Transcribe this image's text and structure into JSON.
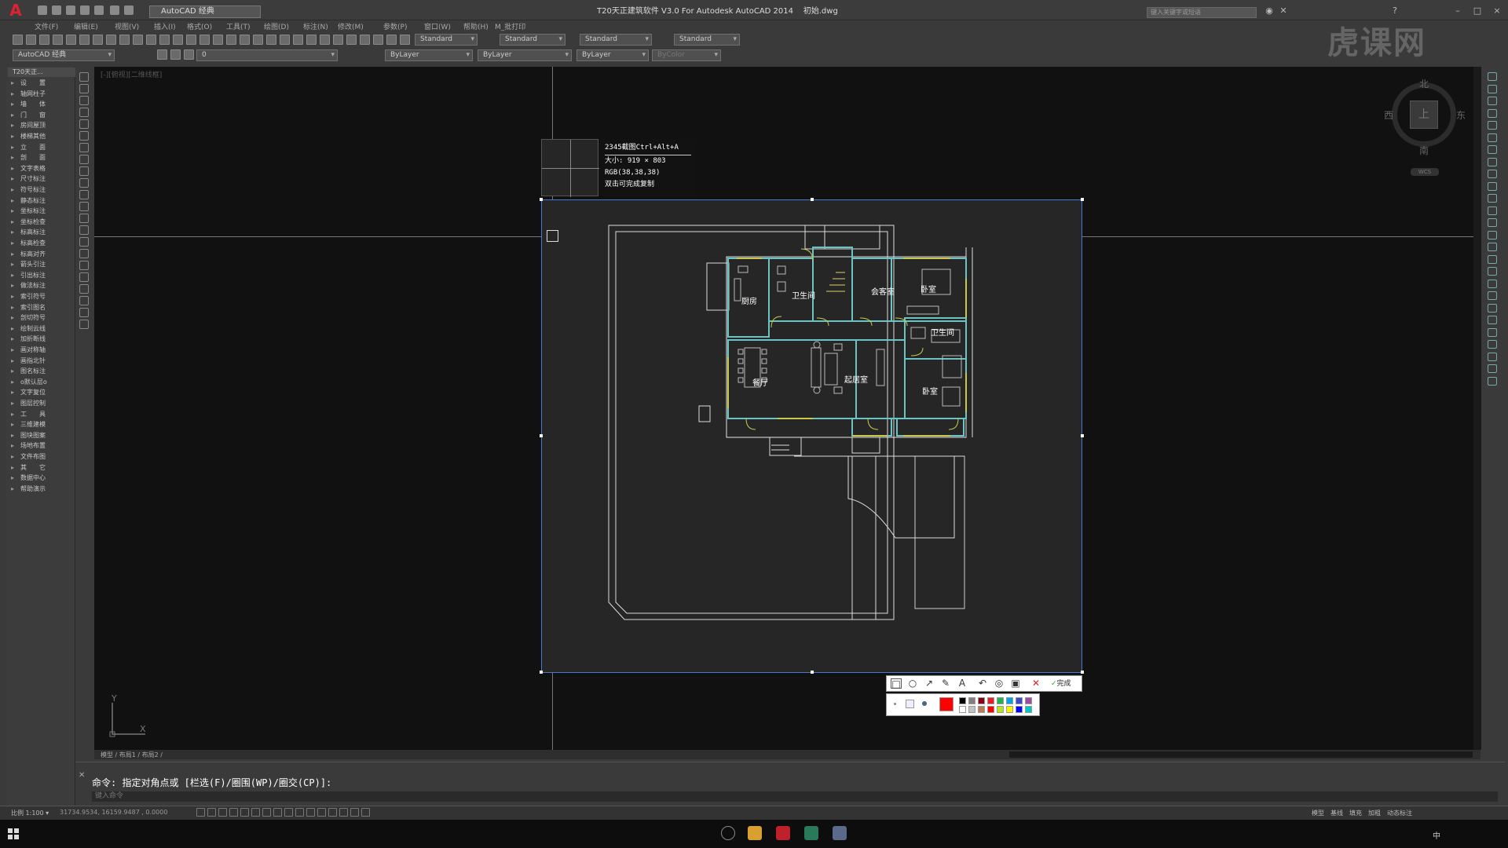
{
  "titlebar": {
    "workspace": "AutoCAD 经典",
    "app_title": "T20天正建筑软件 V3.0 For Autodesk AutoCAD 2014",
    "file_name": "初始.dwg",
    "search_placeholder": "键入关键字或短语"
  },
  "menus": [
    "文件(F)",
    "编辑(E)",
    "视图(V)",
    "插入(I)",
    "格式(O)",
    "工具(T)",
    "绘图(D)",
    "标注(N)",
    "修改(M)",
    "参数(P)",
    "窗口(W)",
    "帮助(H)",
    "M_批打印"
  ],
  "toolbar": {
    "styles": [
      "Standard",
      "Standard",
      "Standard",
      "Standard"
    ],
    "workspace2": "AutoCAD 经典",
    "layer": "0",
    "color": "ByLayer",
    "linetype": "ByLayer",
    "lineweight": "ByLayer",
    "plotstyle": "ByColor"
  },
  "left_panel": {
    "title": "T20天正...",
    "items": [
      "设　　置",
      "轴网柱子",
      "墙　　体",
      "门　　窗",
      "房间屋顶",
      "楼梯其他",
      "立　　面",
      "剖　　面",
      "文字表格",
      "尺寸标注",
      "符号标注",
      "静态标注",
      "坐标标注",
      "坐标检查",
      "标高标注",
      "标高检查",
      "标高对齐",
      "箭头引注",
      "引出标注",
      "做法标注",
      "索引符号",
      "索引图名",
      "剖切符号",
      "绘制云线",
      "加折断线",
      "画对称轴",
      "画指北针",
      "图名标注",
      "o默认层o",
      "文字复位",
      "图层控制",
      "工　　具",
      "三维建模",
      "图块图案",
      "场地布置",
      "文件布图",
      "其　　它",
      "数据中心",
      "帮助演示"
    ]
  },
  "viewport": {
    "label": "[-][俯视][二维线框]",
    "ucs_x": "X",
    "ucs_y": "Y"
  },
  "viewcube": {
    "north": "北",
    "south": "南",
    "east": "东",
    "west": "西",
    "top": "上",
    "wcs": "WCS"
  },
  "capture": {
    "title": "2345截图Ctrl+Alt+A",
    "size": "大小: 919 × 803",
    "rgb": "RGB(38,38,38)",
    "hint": "双击可完成复制",
    "done": "完成"
  },
  "rooms": {
    "kitchen": "厨房",
    "bath1": "卫生间",
    "meeting": "会客室",
    "bedroom1": "卧室",
    "bath2": "卫生间",
    "dining": "餐厅",
    "living": "起居室",
    "bedroom2": "卧室"
  },
  "tabs": "模型 / 布局1 / 布局2 /",
  "command": {
    "line": "命令: 指定对角点或 [栏选(F)/圈围(WP)/圈交(CP)]:",
    "placeholder": "键入命令"
  },
  "status": {
    "scale": "比例 1:100 ▾",
    "coords": "31734.9534, 16159.9487 , 0.0000",
    "right_items": [
      "模型",
      "基线",
      "填充",
      "加粗",
      "动态标注"
    ]
  },
  "taskbar": {
    "ime": "中",
    "watermark": "虎课网"
  },
  "palette": [
    "#000000",
    "#7f7f7f",
    "#880015",
    "#ed1c24",
    "#22b14c",
    "#00a2e8",
    "#3f48cc",
    "#a349a4",
    "#ffffff",
    "#c3c3c3",
    "#b97a57",
    "#ff0000",
    "#b5e61d",
    "#fff200",
    "#0000ff",
    "#00c8c8"
  ]
}
